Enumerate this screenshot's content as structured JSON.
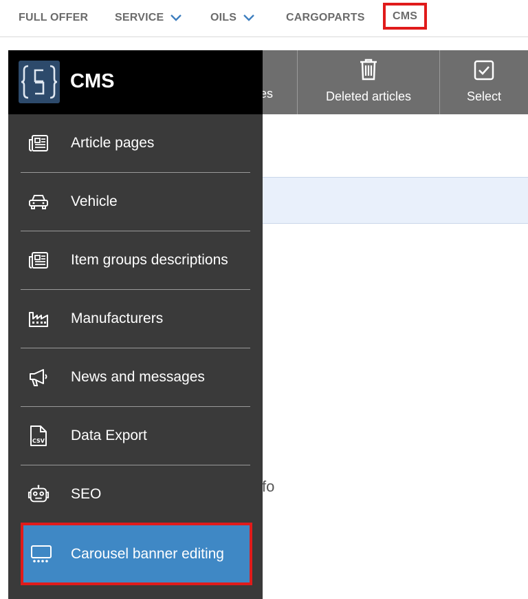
{
  "topnav": {
    "items": [
      {
        "label": "FULL OFFER"
      },
      {
        "label": "SERVICE"
      },
      {
        "label": "OILS"
      },
      {
        "label": "CARGOPARTS"
      },
      {
        "label": "CMS"
      }
    ]
  },
  "toolbar": {
    "partial_label": "es",
    "deleted_label": "Deleted articles",
    "select_label": "Select"
  },
  "background": {
    "partial_text": "fo"
  },
  "sidemenu": {
    "title": "CMS",
    "items": [
      {
        "label": "Article pages",
        "icon": "newspaper-icon"
      },
      {
        "label": "Vehicle",
        "icon": "car-icon"
      },
      {
        "label": "Item groups descriptions",
        "icon": "newspaper-icon"
      },
      {
        "label": "Manufacturers",
        "icon": "factory-icon"
      },
      {
        "label": "News and messages",
        "icon": "megaphone-icon"
      },
      {
        "label": "Data Export",
        "icon": "csv-file-icon"
      },
      {
        "label": "SEO",
        "icon": "robot-icon"
      },
      {
        "label": "Carousel banner editing",
        "icon": "carousel-icon"
      }
    ]
  },
  "colors": {
    "highlight_border": "#e01b1b",
    "active_item": "#3f88c5",
    "menu_bg": "#3a3a3a",
    "header_bg": "#000000",
    "toolbar_bg": "#6e6e6e"
  }
}
